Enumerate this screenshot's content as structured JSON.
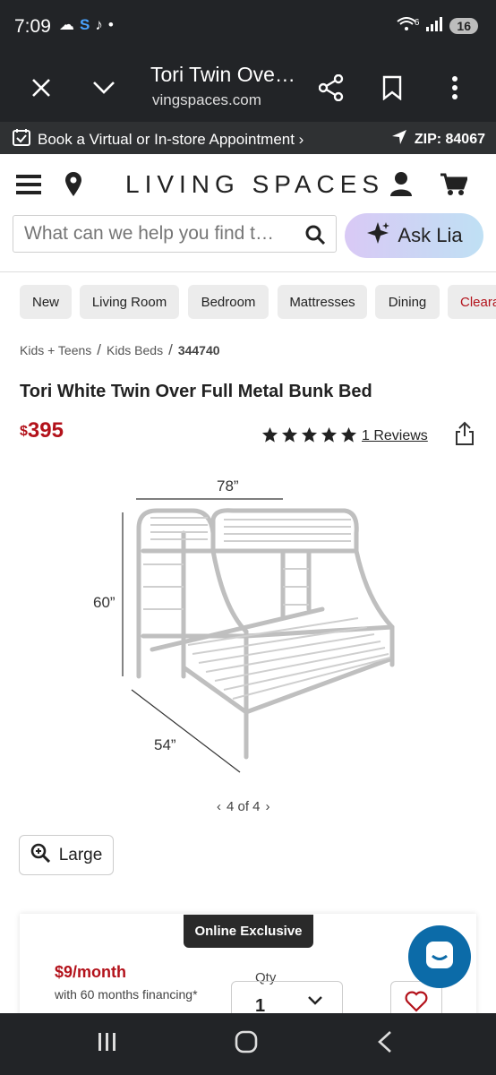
{
  "status_bar": {
    "time": "7:09",
    "network": "6",
    "battery": "16"
  },
  "browser": {
    "title": "Tori Twin Ove…",
    "url": "vingspaces.com"
  },
  "promo": {
    "appointment": "Book a Virtual or In-store Appointment ›",
    "zip": "ZIP: 84067"
  },
  "header": {
    "logo": "LIVING SPACES",
    "search_placeholder": "What can we help you find t…",
    "ask_label": "Ask Lia"
  },
  "categories": [
    "New",
    "Living Room",
    "Bedroom",
    "Mattresses",
    "Dining",
    "Cleara"
  ],
  "breadcrumb": {
    "items": [
      "Kids + Teens",
      "Kids Beds"
    ],
    "current": "344740",
    "sep": "/"
  },
  "product": {
    "title": "Tori White Twin Over Full Metal Bunk Bed",
    "currency": "$",
    "price": "395",
    "rating": 5,
    "reviews": "1 Reviews",
    "dims": {
      "width": "78”",
      "height": "60”",
      "depth": "54”"
    },
    "pager": "4 of 4",
    "large_label": "Large"
  },
  "purchase": {
    "badge": "Online Exclusive",
    "monthly": "$9/month",
    "financing": "with 60 months financing*",
    "qty_label": "Qty",
    "qty_value": "1"
  },
  "colors": {
    "brand_red": "#b3121b",
    "chat_blue": "#0c6ba8",
    "system_bar": "#222427"
  }
}
